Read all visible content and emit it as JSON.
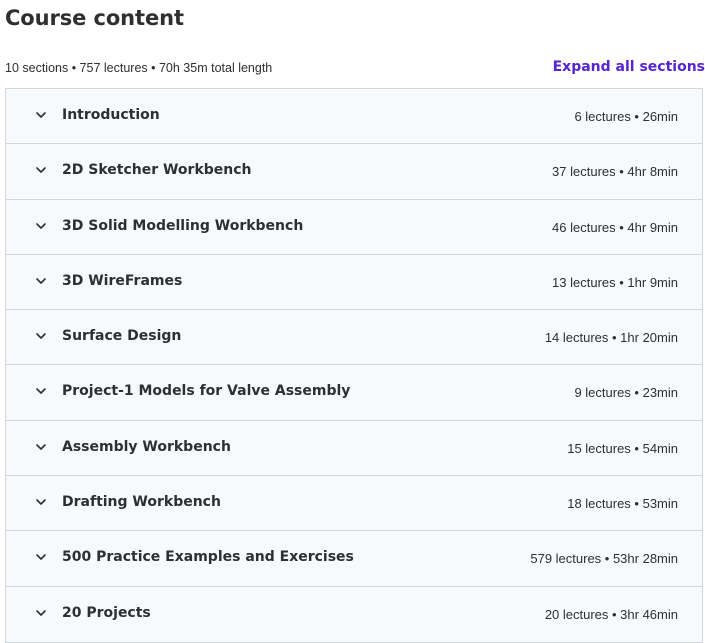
{
  "header": {
    "title": "Course content",
    "summary": "10 sections • 757 lectures • 70h 35m total length",
    "expand_all_label": "Expand all sections"
  },
  "colors": {
    "accent": "#5624d0",
    "border": "#d1d7dc",
    "row_bg": "#f7f9fa",
    "text": "#2d2f31"
  },
  "sections": [
    {
      "title": "Introduction",
      "meta": "6 lectures • 26min",
      "icon": "chevron-down-icon"
    },
    {
      "title": "2D Sketcher Workbench",
      "meta": "37 lectures • 4hr 8min",
      "icon": "chevron-down-icon"
    },
    {
      "title": "3D Solid Modelling Workbench",
      "meta": "46 lectures • 4hr 9min",
      "icon": "chevron-down-icon"
    },
    {
      "title": "3D WireFrames",
      "meta": "13 lectures • 1hr 9min",
      "icon": "chevron-down-icon"
    },
    {
      "title": "Surface Design",
      "meta": "14 lectures • 1hr 20min",
      "icon": "chevron-down-icon"
    },
    {
      "title": "Project-1 Models for Valve Assembly",
      "meta": "9 lectures • 23min",
      "icon": "chevron-down-icon"
    },
    {
      "title": "Assembly Workbench",
      "meta": "15 lectures • 54min",
      "icon": "chevron-down-icon"
    },
    {
      "title": "Drafting Workbench",
      "meta": "18 lectures • 53min",
      "icon": "chevron-down-icon"
    },
    {
      "title": "500 Practice Examples and Exercises",
      "meta": "579 lectures • 53hr 28min",
      "icon": "chevron-down-icon"
    },
    {
      "title": "20 Projects",
      "meta": "20 lectures • 3hr 46min",
      "icon": "chevron-down-icon"
    }
  ]
}
